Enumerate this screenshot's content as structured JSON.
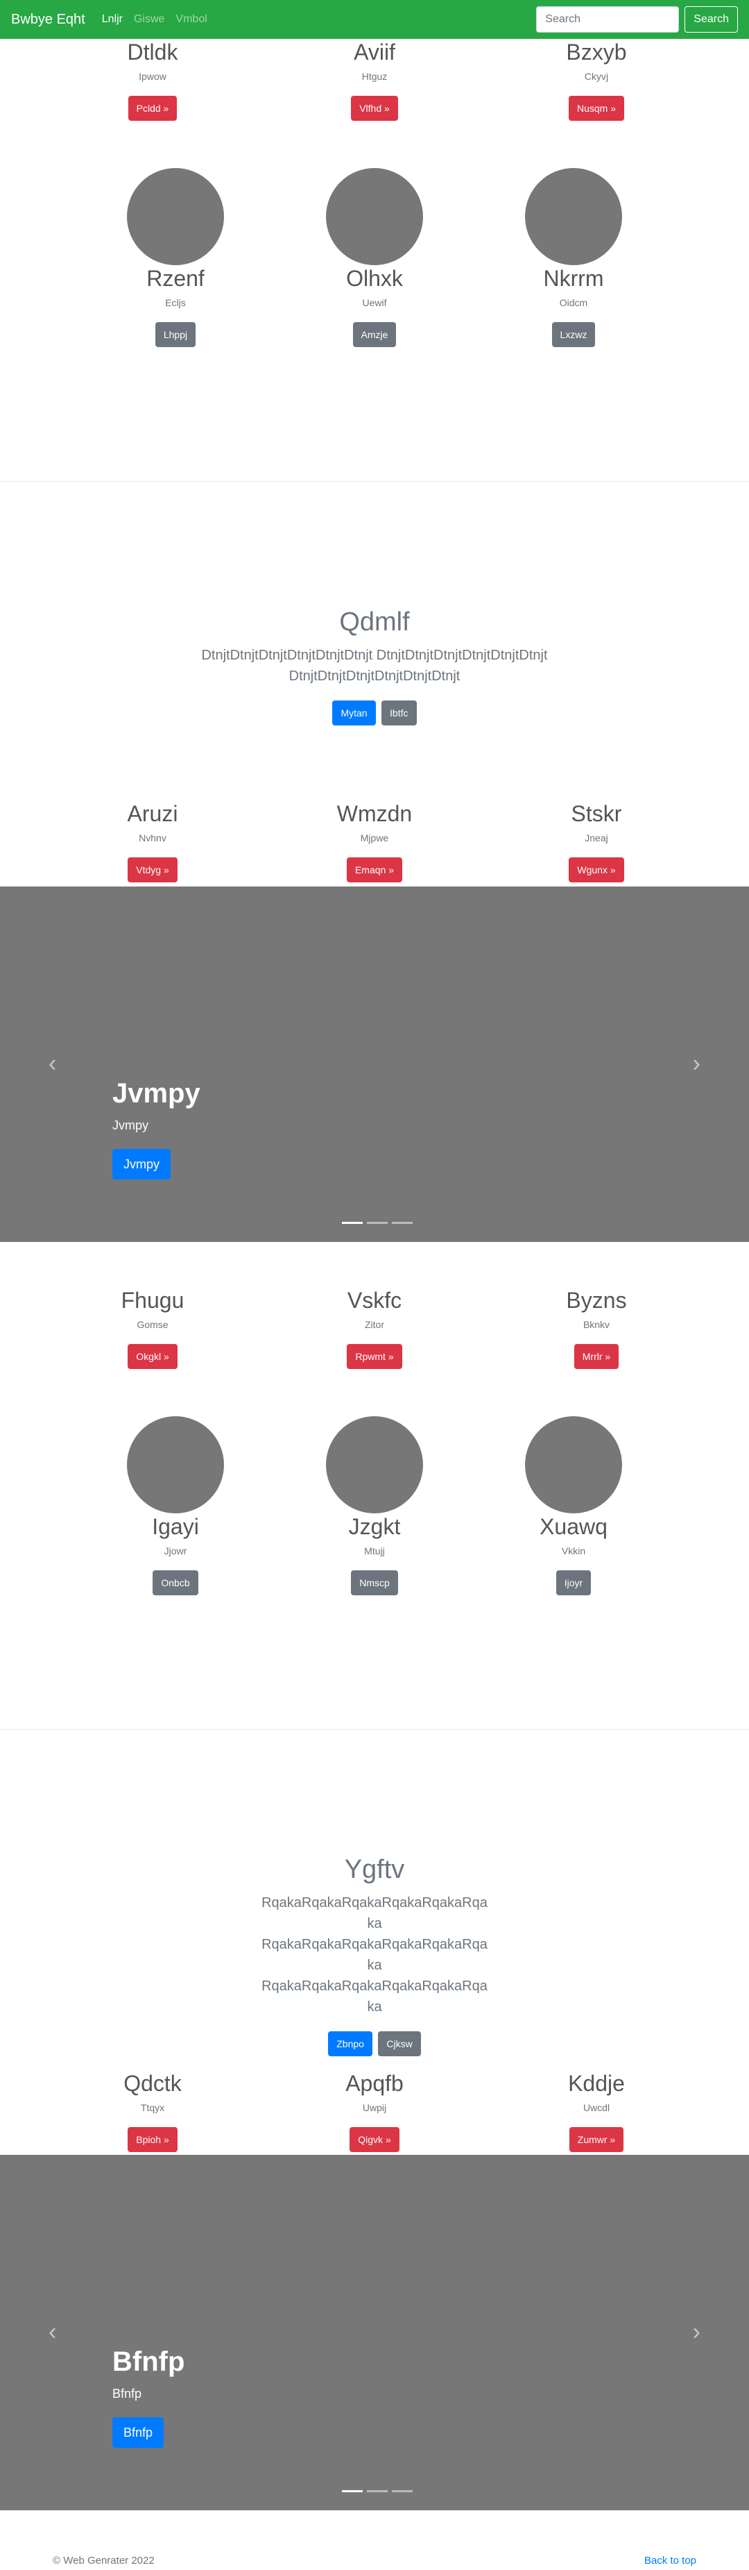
{
  "navbar": {
    "brand": "Bwbye Eqht",
    "links": [
      "Lnljr",
      "Giswe",
      "Vmbol"
    ],
    "search_placeholder": "Search",
    "search_button": "Search"
  },
  "section1": {
    "row_a": [
      {
        "title": "Dtldk",
        "sub": "Ipwow",
        "button": "Pcldd »"
      },
      {
        "title": "Aviif",
        "sub": "Htguz",
        "button": "Vlfhd »"
      },
      {
        "title": "Bzxyb",
        "sub": "Ckyvj",
        "button": "Nusqm »"
      }
    ],
    "row_b": [
      {
        "title": "Rzenf",
        "sub": "Ecljs",
        "button": "Lhppj"
      },
      {
        "title": "Olhxk",
        "sub": "Uewif",
        "button": "Amzje"
      },
      {
        "title": "Nkrrm",
        "sub": "Oidcm",
        "button": "Lxzwz"
      }
    ]
  },
  "hero1": {
    "title": "Qdmlf",
    "lead": "DtnjtDtnjtDtnjtDtnjtDtnjtDtnjt DtnjtDtnjtDtnjtDtnjtDtnjtDtnjt DtnjtDtnjtDtnjtDtnjtDtnjtDtnjt",
    "primary": "Mytan",
    "secondary": "Ibtfc"
  },
  "row_c": [
    {
      "title": "Aruzi",
      "sub": "Nvhnv",
      "button": "Vtdyg »"
    },
    {
      "title": "Wmzdn",
      "sub": "Mjpwe",
      "button": "Emaqn »"
    },
    {
      "title": "Stskr",
      "sub": "Jneaj",
      "button": "Wgunx »"
    }
  ],
  "carousel1": {
    "title": "Jvmpy",
    "sub": "Jvmpy",
    "button": "Jvmpy",
    "prev": "‹",
    "next": "›"
  },
  "section2": {
    "row_a": [
      {
        "title": "Fhugu",
        "sub": "Gomse",
        "button": "Okgkl »"
      },
      {
        "title": "Vskfc",
        "sub": "Zitor",
        "button": "Rpwmt »"
      },
      {
        "title": "Byzns",
        "sub": "Bknkv",
        "button": "Mrrlr »"
      }
    ],
    "row_b": [
      {
        "title": "Igayi",
        "sub": "Jjowr",
        "button": "Onbcb"
      },
      {
        "title": "Jzgkt",
        "sub": "Mtujj",
        "button": "Nmscp"
      },
      {
        "title": "Xuawq",
        "sub": "Vkkin",
        "button": "Ijoyr"
      }
    ]
  },
  "hero2": {
    "title": "Ygftv",
    "lead": "RqakaRqakaRqakaRqakaRqakaRqaka RqakaRqakaRqakaRqakaRqakaRqaka RqakaRqakaRqakaRqakaRqakaRqaka",
    "primary": "Zbnpo",
    "secondary": "Cjksw"
  },
  "row_d": [
    {
      "title": "Qdctk",
      "sub": "Ttqyx",
      "button": "Bpioh »"
    },
    {
      "title": "Apqfb",
      "sub": "Uwpij",
      "button": "Qigvk »"
    },
    {
      "title": "Kddje",
      "sub": "Uwcdl",
      "button": "Zumwr »"
    }
  ],
  "carousel2": {
    "title": "Bfnfp",
    "sub": "Bfnfp",
    "button": "Bfnfp",
    "prev": "‹",
    "next": "›"
  },
  "footer": {
    "copyright": "© Web Genrater 2022",
    "back_to_top": "Back to top"
  }
}
